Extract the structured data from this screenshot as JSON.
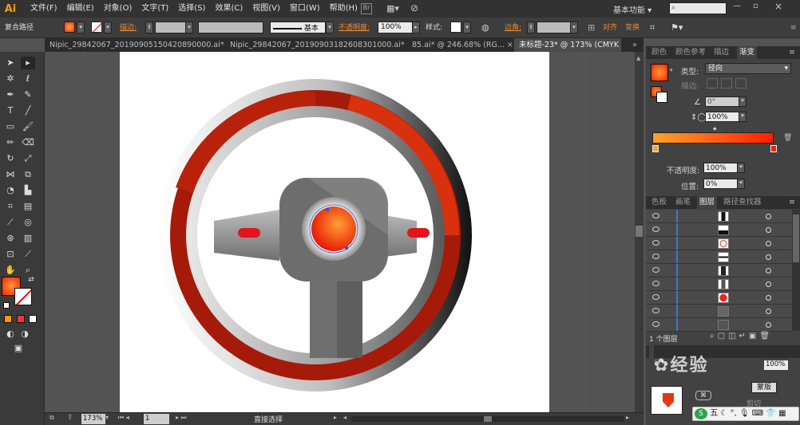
{
  "app": {
    "logo": "Ai",
    "workspace": "基本功能",
    "search_placeholder": ""
  },
  "menu": [
    "文件(F)",
    "编辑(E)",
    "对象(O)",
    "文字(T)",
    "选择(S)",
    "效果(C)",
    "视图(V)",
    "窗口(W)",
    "帮助(H)"
  ],
  "control": {
    "selection_type": "复合路径",
    "stroke_label": "描边:",
    "stroke_style": "基本",
    "opacity_label": "不透明度:",
    "opacity_value": "100%",
    "style_label": "样式:",
    "corner_label": "边角:",
    "align_label": "对齐",
    "transform_label": "变换"
  },
  "tabs": [
    {
      "label": "Nipic_29842067_20190905150420890000.ai*",
      "close": "×",
      "active": false
    },
    {
      "label": "Nipic_29842067_20190903182608301000.ai*",
      "close": "×",
      "active": false
    },
    {
      "label": "85.ai* @ 246.68% (RG...",
      "close": "×",
      "active": false
    },
    {
      "label": "未标题-23* @ 173% (CMYK",
      "close": "×",
      "active": true
    }
  ],
  "status": {
    "zoom": "173%",
    "page": "1",
    "tool": "直接选择"
  },
  "gradient_panel": {
    "tabs": [
      "颜色",
      "颜色参考",
      "描边",
      "渐变"
    ],
    "type_label": "类型:",
    "type_value": "径向",
    "stroke_label": "描边:",
    "angle_value": "0°",
    "aspect_value": "100%",
    "opacity_label": "不透明度:",
    "opacity_value": "100%",
    "location_label": "位置:",
    "location_value": "0%"
  },
  "layers_panel": {
    "tabs": [
      "色板",
      "画笔",
      "图层",
      "路径查找器"
    ],
    "footer_text": "1 个图层"
  },
  "bottom_panel": {
    "opacity_value": "100%",
    "button_mask": "蒙版",
    "clip_label": "剪切",
    "ime_label": "五"
  },
  "watermark": {
    "text": "经验"
  },
  "colors": {
    "accent": "#f08a2c",
    "red": "#d62a0c",
    "dark_red": "#a31a07",
    "artboard": "#ffffff"
  }
}
